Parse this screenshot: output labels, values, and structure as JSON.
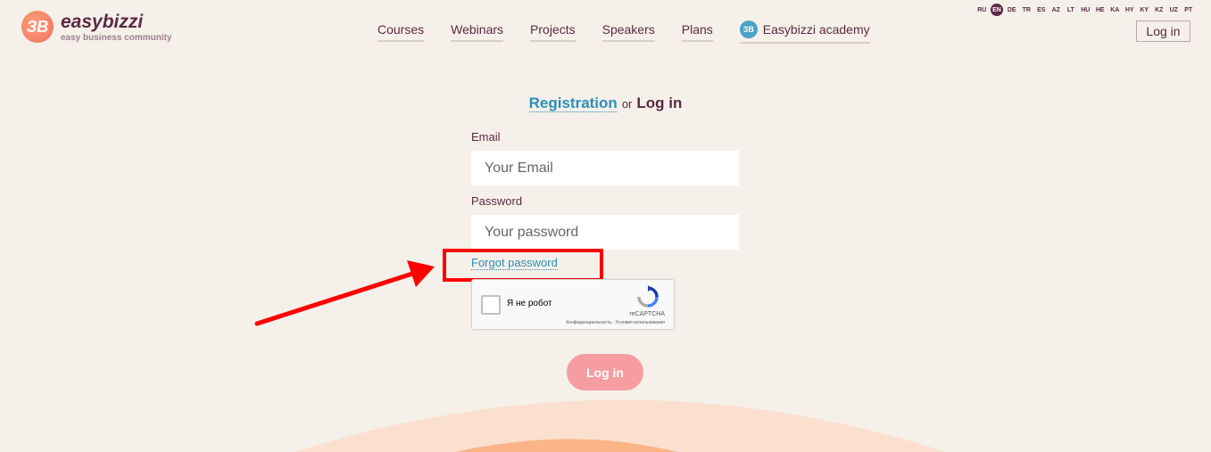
{
  "brand": {
    "mark": "ЗB",
    "name": "easybizzi",
    "tagline": "easy business community"
  },
  "nav": {
    "items": [
      "Courses",
      "Webinars",
      "Projects",
      "Speakers",
      "Plans"
    ],
    "academy_icon": "ЗB",
    "academy_label": "Easybizzi academy"
  },
  "languages": {
    "items": [
      "RU",
      "EN",
      "DE",
      "TR",
      "ES",
      "AZ",
      "LT",
      "HU",
      "HE",
      "KA",
      "HY",
      "KY",
      "KZ",
      "UZ",
      "PT"
    ],
    "active": "EN"
  },
  "header": {
    "login_label": "Log in"
  },
  "form": {
    "register_tab": "Registration",
    "or_text": "or",
    "login_tab": "Log in",
    "email_label": "Email",
    "email_placeholder": "Your Email",
    "password_label": "Password",
    "password_placeholder": "Your password",
    "forgot_label": "Forgot password",
    "submit_label": "Log in"
  },
  "captcha": {
    "label": "Я не робот",
    "brand": "reCAPTCHA",
    "terms": "Конфиденциальность - Условия использования"
  },
  "annotation": {
    "highlight_color": "#ff0000"
  }
}
